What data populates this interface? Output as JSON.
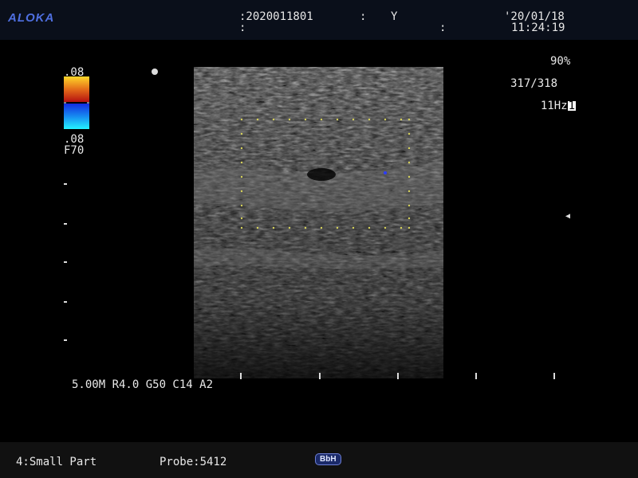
{
  "header": {
    "brand": "ALOKA",
    "patient_id": ":2020011801",
    "colon_1": ":",
    "colon_2": ":",
    "flag": "Y",
    "date": "'20/01/18",
    "time": "11:24:19",
    "colon_3": ":"
  },
  "left_panel": {
    "color_scale_top": ".08",
    "color_scale_bottom": ".08",
    "filter": "F70"
  },
  "right_panel": {
    "gain_percent": "90%",
    "frame": "317/318",
    "rate": "11Hz",
    "rate_box": "1"
  },
  "status_line": "5.00M R4.0 G50 C14 A2",
  "footer": {
    "preset": "4:Small Part",
    "probe": "Probe:5412",
    "badge": "BbH"
  },
  "colors": {
    "background": "#000000",
    "header_bg": "#0a0f1a",
    "brand": "#4f6fe0",
    "text": "#e8e8e8",
    "roi_dots": "#d7d35a",
    "badge_bg": "#1b2a69"
  },
  "icons": {
    "dot": "focus-dot-icon",
    "marker": "triangle-marker-icon"
  }
}
